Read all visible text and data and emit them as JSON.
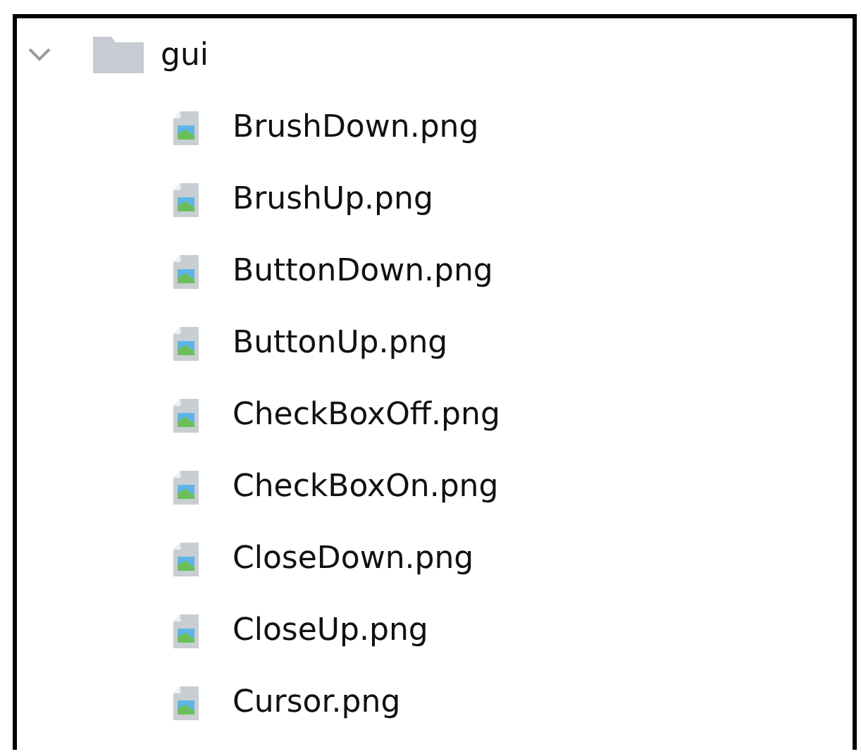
{
  "tree": [
    {
      "name": "gui",
      "kind": "folder",
      "expanded": true,
      "children": [
        {
          "name": "BrushDown.png",
          "kind": "image"
        },
        {
          "name": "BrushUp.png",
          "kind": "image"
        },
        {
          "name": "ButtonDown.png",
          "kind": "image"
        },
        {
          "name": "ButtonUp.png",
          "kind": "image"
        },
        {
          "name": "CheckBoxOff.png",
          "kind": "image"
        },
        {
          "name": "CheckBoxOn.png",
          "kind": "image"
        },
        {
          "name": "CloseDown.png",
          "kind": "image"
        },
        {
          "name": "CloseUp.png",
          "kind": "image"
        },
        {
          "name": "Cursor.png",
          "kind": "image"
        }
      ]
    }
  ]
}
